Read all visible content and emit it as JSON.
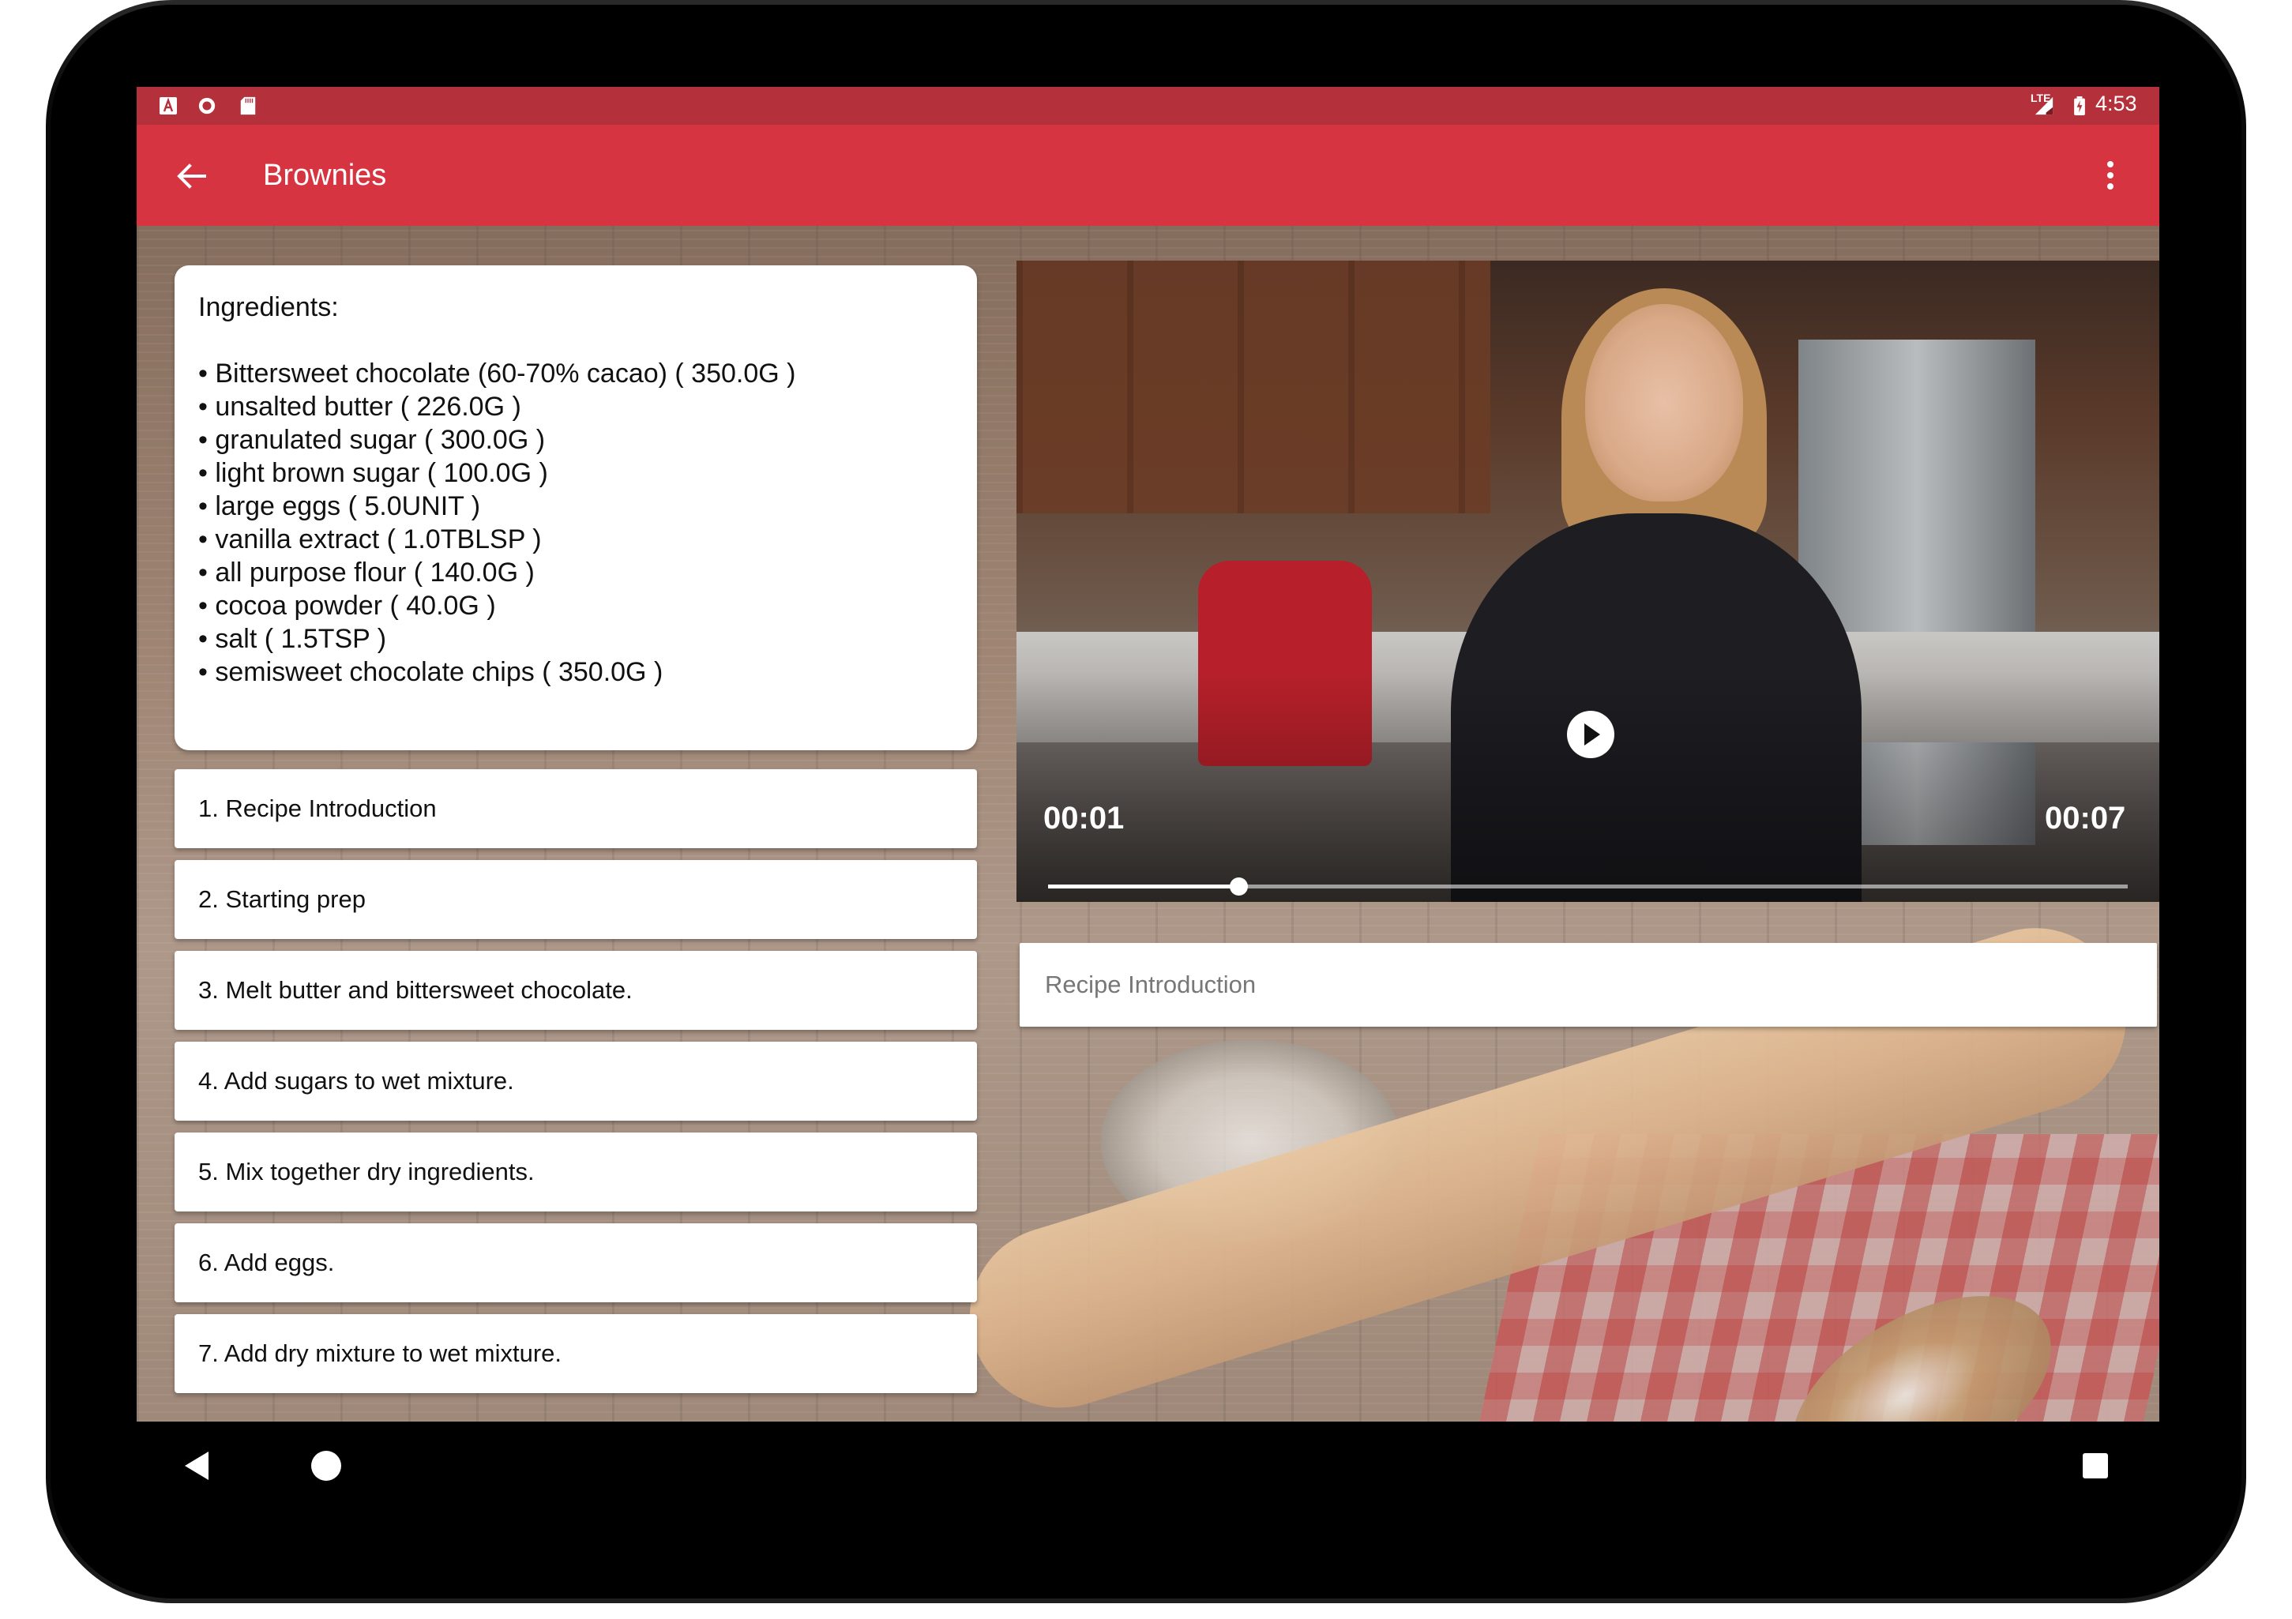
{
  "status_bar": {
    "time": "4:53",
    "network": "LTE",
    "left_icons": [
      "app-a-icon",
      "record-icon",
      "sd-card-icon"
    ],
    "right_icons": [
      "signal-icon",
      "battery-charging-icon"
    ],
    "color": "#b4303a"
  },
  "app_bar": {
    "title": "Brownies",
    "back_icon": "arrow-back-icon",
    "menu_icon": "more-vert-icon",
    "color": "#d63441"
  },
  "ingredients": {
    "heading": "Ingredients:",
    "items": [
      "• Bittersweet chocolate (60-70% cacao) ( 350.0G )",
      "• unsalted butter ( 226.0G )",
      "• granulated sugar ( 300.0G )",
      "• light brown sugar ( 100.0G )",
      "• large eggs ( 5.0UNIT )",
      "• vanilla extract ( 1.0TBLSP )",
      "• all purpose flour ( 140.0G )",
      "• cocoa powder ( 40.0G )",
      "• salt ( 1.5TSP )",
      "• semisweet chocolate chips ( 350.0G )"
    ]
  },
  "steps": [
    "1. Recipe Introduction",
    "2. Starting prep",
    "3. Melt butter and bittersweet chocolate.",
    "4. Add sugars to wet mixture.",
    "5. Mix together dry ingredients.",
    "6. Add eggs.",
    "7. Add dry mixture to wet mixture."
  ],
  "player": {
    "current_time": "00:01",
    "total_time": "00:07",
    "progress_fraction": 0.176,
    "play_icon": "play-icon"
  },
  "current_step_title": "Recipe Introduction",
  "nav_bar": {
    "icons": [
      "nav-back-icon",
      "nav-home-icon",
      "nav-recents-icon"
    ]
  }
}
